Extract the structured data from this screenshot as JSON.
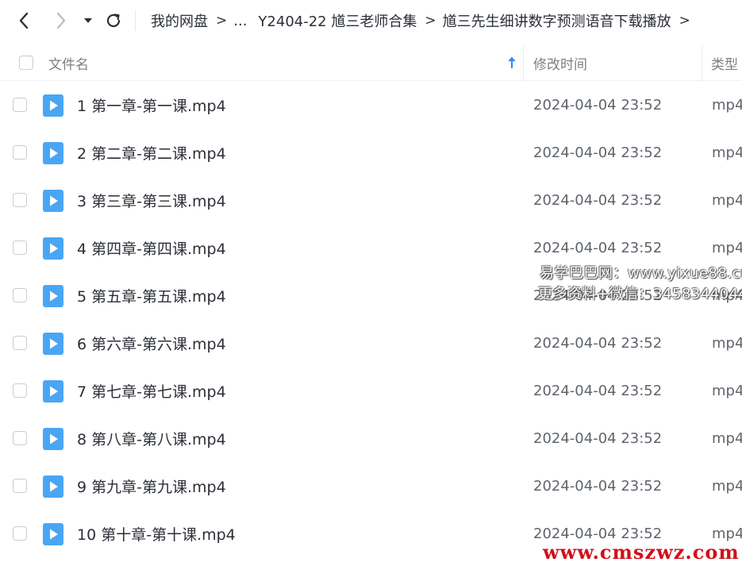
{
  "breadcrumb": {
    "items": [
      "我的网盘",
      "...",
      "Y2404-22 馗三老师合集",
      "馗三先生细讲数字预测语音下载播放"
    ],
    "separator": ">"
  },
  "header": {
    "name_label": "文件名",
    "time_label": "修改时间",
    "type_label": "类型",
    "sort_icon": "arrow-up-icon"
  },
  "files": [
    {
      "name": "1 第一章-第一课.mp4",
      "time": "2024-04-04 23:52",
      "type": "mp4"
    },
    {
      "name": "2 第二章-第二课.mp4",
      "time": "2024-04-04 23:52",
      "type": "mp4"
    },
    {
      "name": "3 第三章-第三课.mp4",
      "time": "2024-04-04 23:52",
      "type": "mp4"
    },
    {
      "name": "4 第四章-第四课.mp4",
      "time": "2024-04-04 23:52",
      "type": "mp4"
    },
    {
      "name": "5 第五章-第五课.mp4",
      "time": "2024-04-04 23:52",
      "type": "mp4"
    },
    {
      "name": "6 第六章-第六课.mp4",
      "time": "2024-04-04 23:52",
      "type": "mp4"
    },
    {
      "name": "7 第七章-第七课.mp4",
      "time": "2024-04-04 23:52",
      "type": "mp4"
    },
    {
      "name": "8 第八章-第八课.mp4",
      "time": "2024-04-04 23:52",
      "type": "mp4"
    },
    {
      "name": "9 第九章-第九课.mp4",
      "time": "2024-04-04 23:52",
      "type": "mp4"
    },
    {
      "name": "10 第十章-第十课.mp4",
      "time": "2024-04-04 23:52",
      "type": "mp4"
    }
  ],
  "watermarks": {
    "line1": "易学巴巴网：www.yixue88.cn",
    "line2": "更多资料+微信：3458344044",
    "site": "www.cmszwz.com"
  },
  "colors": {
    "accent": "#2f8cf8",
    "video_icon": "#49a6f5",
    "site_watermark": "#d0101a"
  }
}
